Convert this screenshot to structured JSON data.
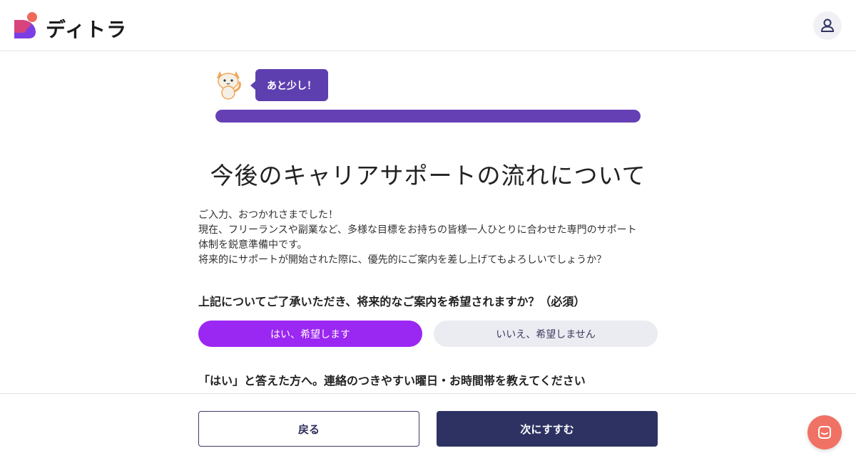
{
  "header": {
    "brand": "ディトラ",
    "logo_icon": "ditora-logo-icon",
    "user_icon": "user-icon"
  },
  "progress": {
    "bubble_text": "あと少し！",
    "mascot_icon": "cat-mascot-icon",
    "percent": 100,
    "color": "#6540b4"
  },
  "main": {
    "title": "今後のキャリアサポートの流れについて",
    "intro": [
      "ご入力、おつかれさまでした！",
      "現在、フリーランスや副業など、多様な目標をお持ちの皆様一人ひとりに合わせた専門のサポート",
      "体制を鋭意準備中です。",
      "将来的にサポートが開始された際に、優先的にご案内を差し上げてもよろしいでしょうか？"
    ],
    "question": "上記についてご了承いただき、将来的なご案内を希望されますか？（必須）",
    "options": [
      {
        "label": "はい、希望します",
        "selected": true
      },
      {
        "label": "いいえ、希望しません",
        "selected": false
      }
    ],
    "question2": "「はい」と答えた方へ。連絡のつきやすい曜日・お時間帯を教えてください"
  },
  "footer": {
    "back_label": "戻る",
    "next_label": "次にすすむ",
    "chat_icon": "chat-icon"
  },
  "colors": {
    "accent_purple": "#9b27f2",
    "navy": "#2e3262",
    "chat": "#f07264"
  }
}
